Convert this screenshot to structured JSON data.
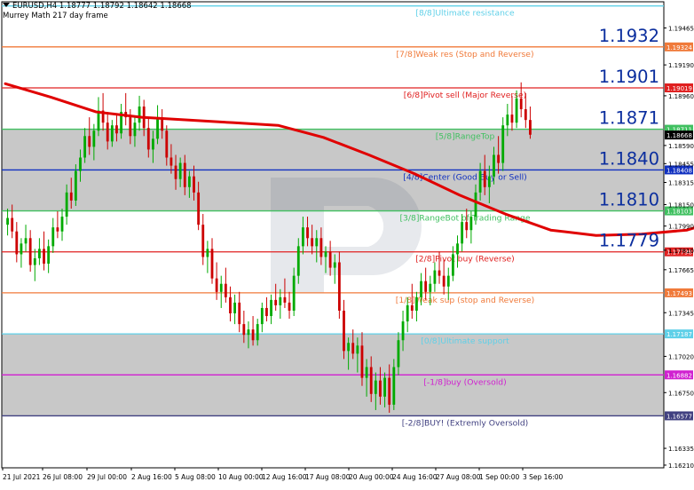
{
  "header": {
    "symbol_line": "EURUSD,H4  1.18777 1.18792 1.18642 1.18668",
    "indicator_line": "Murrey Math 217 day frame"
  },
  "colors": {
    "band_fill": "#c8c8c8",
    "bull": "#00aa00",
    "bear": "#cc0000",
    "ma": "#e00000",
    "arrow": "#0a2fd8",
    "big_label": "#0b2e9e"
  },
  "chart_data": {
    "type": "candlestick",
    "symbol": "EURUSD",
    "timeframe": "H4",
    "ohlc_last": {
      "open": 1.18777,
      "high": 1.18792,
      "low": 1.18642,
      "close": 1.18668
    },
    "ylim": [
      1.1619,
      1.1966
    ],
    "yticks": [
      1.19465,
      1.1919,
      1.1896,
      1.1859,
      1.18455,
      1.18315,
      1.1815,
      1.1799,
      1.1781,
      1.17665,
      1.17345,
      1.1702,
      1.1675,
      1.16335,
      1.1621
    ],
    "x_tick_labels": [
      "21 Jul 2021",
      "26 Jul 08:00",
      "29 Jul 00:00",
      "2 Aug 16:00",
      "5 Aug 08:00",
      "10 Aug 00:00",
      "12 Aug 16:00",
      "17 Aug 08:00",
      "20 Aug 00:00",
      "24 Aug 16:00",
      "27 Aug 08:00",
      "1 Sep 00:00",
      "3 Sep 16:00"
    ],
    "murrey_levels": [
      {
        "name": "[8/8]Ultimate resistance",
        "price": 1.19629,
        "color": "#5fd0e8",
        "price_label": ""
      },
      {
        "name": "[7/8]Weak res (Stop and Reverse)",
        "price": 1.19324,
        "color": "#f07a3a",
        "price_label": "1.19324"
      },
      {
        "name": "[6/8]Pivot sell (Major Reverse)",
        "price": 1.19019,
        "color": "#e02020",
        "price_label": "1.19019"
      },
      {
        "name": "[5/8]RangeTop",
        "price": 1.18711,
        "color": "#40c060",
        "price_label": "1.18711"
      },
      {
        "name": "[4/8]Center (Good Buy or Sell)",
        "price": 1.18408,
        "color": "#1030c0",
        "price_label": "1.18408"
      },
      {
        "name": "[3/8]RangeBot of Trading Range",
        "price": 1.18103,
        "color": "#40c060",
        "price_label": "1.18103"
      },
      {
        "name": "[2/8]Pivot buy (Reverse)",
        "price": 1.17798,
        "color": "#e02020",
        "price_label": "1.17798"
      },
      {
        "name": "[1/8]Weak sup (stop and Reverse)",
        "price": 1.17493,
        "color": "#f07a3a",
        "price_label": "1.17493"
      },
      {
        "name": "[0/8]Ultimate support",
        "price": 1.17187,
        "color": "#5fd0e8",
        "price_label": "1.17187"
      },
      {
        "name": "[-1/8]buy (Oversold)",
        "price": 1.16882,
        "color": "#d020d0",
        "price_label": "1.16882"
      },
      {
        "name": "[-2/8]BUY! (Extremly Oversold)",
        "price": 1.16577,
        "color": "#404080",
        "price_label": "1.16577"
      }
    ],
    "current_price_label": "1.18668",
    "big_labels": [
      "1.1932",
      "1.1901",
      "1.1871",
      "1.1840",
      "1.1810",
      "1.1779"
    ],
    "moving_average": {
      "period_label": "217 day frame",
      "points": [
        [
          0,
          1.1905
        ],
        [
          10,
          1.1895
        ],
        [
          20,
          1.1884
        ],
        [
          30,
          1.188
        ],
        [
          40,
          1.1878
        ],
        [
          50,
          1.1876
        ],
        [
          60,
          1.1874
        ],
        [
          70,
          1.1865
        ],
        [
          80,
          1.1852
        ],
        [
          90,
          1.1838
        ],
        [
          100,
          1.1822
        ],
        [
          110,
          1.1808
        ],
        [
          120,
          1.1796
        ],
        [
          130,
          1.1792
        ],
        [
          140,
          1.1793
        ],
        [
          150,
          1.1796
        ],
        [
          158,
          1.1804
        ]
      ]
    },
    "projection_arrows": [
      {
        "from": [
          161,
          1.1866
        ],
        "to": [
          164,
          1.184
        ]
      },
      {
        "from": [
          164,
          1.184
        ],
        "to": [
          168,
          1.1872
        ]
      },
      {
        "from": [
          168,
          1.1872
        ],
        "to": [
          172,
          1.1898
        ]
      }
    ],
    "candles": [
      [
        1.18,
        1.1812,
        1.1792,
        1.1805
      ],
      [
        1.1805,
        1.1815,
        1.179,
        1.1795
      ],
      [
        1.1795,
        1.1802,
        1.1772,
        1.1778
      ],
      [
        1.1778,
        1.179,
        1.1768,
        1.1786
      ],
      [
        1.1786,
        1.18,
        1.178,
        1.179
      ],
      [
        1.179,
        1.1796,
        1.1765,
        1.177
      ],
      [
        1.177,
        1.1782,
        1.1758,
        1.1775
      ],
      [
        1.1775,
        1.179,
        1.177,
        1.1782
      ],
      [
        1.1782,
        1.1795,
        1.1766,
        1.1771
      ],
      [
        1.1771,
        1.1789,
        1.1764,
        1.1784
      ],
      [
        1.1784,
        1.1805,
        1.1779,
        1.1798
      ],
      [
        1.1798,
        1.181,
        1.179,
        1.1795
      ],
      [
        1.1795,
        1.1812,
        1.1788,
        1.1806
      ],
      [
        1.1806,
        1.183,
        1.18,
        1.1824
      ],
      [
        1.1824,
        1.1835,
        1.1812,
        1.1818
      ],
      [
        1.1818,
        1.1845,
        1.1814,
        1.184
      ],
      [
        1.184,
        1.1856,
        1.1832,
        1.185
      ],
      [
        1.185,
        1.1872,
        1.1846,
        1.1866
      ],
      [
        1.1866,
        1.188,
        1.1852,
        1.1858
      ],
      [
        1.1858,
        1.1875,
        1.1848,
        1.187
      ],
      [
        1.187,
        1.1895,
        1.1866,
        1.1885
      ],
      [
        1.1885,
        1.1898,
        1.187,
        1.1876
      ],
      [
        1.1876,
        1.1884,
        1.1856,
        1.1862
      ],
      [
        1.1862,
        1.1878,
        1.1858,
        1.1874
      ],
      [
        1.1874,
        1.1882,
        1.1862,
        1.1868
      ],
      [
        1.1868,
        1.189,
        1.1864,
        1.1884
      ],
      [
        1.1884,
        1.1898,
        1.1874,
        1.188
      ],
      [
        1.188,
        1.1886,
        1.186,
        1.1866
      ],
      [
        1.1866,
        1.188,
        1.1858,
        1.1876
      ],
      [
        1.1876,
        1.1896,
        1.187,
        1.1888
      ],
      [
        1.1888,
        1.1893,
        1.1866,
        1.1872
      ],
      [
        1.1872,
        1.188,
        1.185,
        1.1856
      ],
      [
        1.1856,
        1.187,
        1.1846,
        1.1864
      ],
      [
        1.1864,
        1.1889,
        1.186,
        1.188
      ],
      [
        1.188,
        1.1886,
        1.1864,
        1.187
      ],
      [
        1.187,
        1.1874,
        1.1844,
        1.185
      ],
      [
        1.185,
        1.186,
        1.1838,
        1.1844
      ],
      [
        1.1844,
        1.1852,
        1.1826,
        1.1834
      ],
      [
        1.1834,
        1.185,
        1.1828,
        1.1846
      ],
      [
        1.1846,
        1.1852,
        1.1822,
        1.1828
      ],
      [
        1.1828,
        1.184,
        1.182,
        1.1836
      ],
      [
        1.1836,
        1.1844,
        1.1818,
        1.1824
      ],
      [
        1.1824,
        1.1832,
        1.1796,
        1.18
      ],
      [
        1.18,
        1.1808,
        1.177,
        1.1776
      ],
      [
        1.1776,
        1.1788,
        1.1764,
        1.1782
      ],
      [
        1.1782,
        1.179,
        1.1756,
        1.176
      ],
      [
        1.176,
        1.1772,
        1.1744,
        1.175
      ],
      [
        1.175,
        1.1762,
        1.1738,
        1.1756
      ],
      [
        1.1756,
        1.1768,
        1.1742,
        1.1746
      ],
      [
        1.1746,
        1.1754,
        1.1728,
        1.1734
      ],
      [
        1.1734,
        1.1748,
        1.1726,
        1.1742
      ],
      [
        1.1742,
        1.175,
        1.172,
        1.1726
      ],
      [
        1.1726,
        1.1736,
        1.1712,
        1.1718
      ],
      [
        1.1718,
        1.1728,
        1.1708,
        1.1722
      ],
      [
        1.1722,
        1.1732,
        1.171,
        1.1714
      ],
      [
        1.1714,
        1.173,
        1.171,
        1.1726
      ],
      [
        1.1726,
        1.1742,
        1.172,
        1.1738
      ],
      [
        1.1738,
        1.1746,
        1.1728,
        1.1732
      ],
      [
        1.1732,
        1.1748,
        1.1726,
        1.1744
      ],
      [
        1.1744,
        1.1756,
        1.1736,
        1.174
      ],
      [
        1.174,
        1.1752,
        1.173,
        1.1746
      ],
      [
        1.1746,
        1.176,
        1.1738,
        1.1742
      ],
      [
        1.1742,
        1.175,
        1.173,
        1.1736
      ],
      [
        1.1736,
        1.1768,
        1.1732,
        1.1762
      ],
      [
        1.1762,
        1.179,
        1.1756,
        1.1784
      ],
      [
        1.1784,
        1.1806,
        1.1778,
        1.1798
      ],
      [
        1.1798,
        1.1806,
        1.1784,
        1.179
      ],
      [
        1.179,
        1.18,
        1.1778,
        1.1784
      ],
      [
        1.1784,
        1.1796,
        1.1772,
        1.179
      ],
      [
        1.179,
        1.1798,
        1.177,
        1.1776
      ],
      [
        1.1776,
        1.1784,
        1.1764,
        1.178
      ],
      [
        1.178,
        1.1788,
        1.1762,
        1.1768
      ],
      [
        1.1768,
        1.1778,
        1.1756,
        1.1772
      ],
      [
        1.1772,
        1.178,
        1.173,
        1.1736
      ],
      [
        1.1736,
        1.1744,
        1.17,
        1.1706
      ],
      [
        1.1706,
        1.1716,
        1.1692,
        1.1712
      ],
      [
        1.1712,
        1.1722,
        1.17,
        1.1704
      ],
      [
        1.1704,
        1.1716,
        1.169,
        1.171
      ],
      [
        1.171,
        1.172,
        1.168,
        1.1686
      ],
      [
        1.1686,
        1.17,
        1.1672,
        1.1694
      ],
      [
        1.1694,
        1.1702,
        1.1668,
        1.1674
      ],
      [
        1.1674,
        1.169,
        1.1662,
        1.1684
      ],
      [
        1.1684,
        1.1694,
        1.1666,
        1.1672
      ],
      [
        1.1672,
        1.169,
        1.1664,
        1.1686
      ],
      [
        1.1686,
        1.1696,
        1.166,
        1.1666
      ],
      [
        1.1666,
        1.17,
        1.1662,
        1.1694
      ],
      [
        1.1694,
        1.172,
        1.1688,
        1.1714
      ],
      [
        1.1714,
        1.1736,
        1.1706,
        1.1728
      ],
      [
        1.1728,
        1.1746,
        1.172,
        1.174
      ],
      [
        1.174,
        1.1756,
        1.173,
        1.1736
      ],
      [
        1.1736,
        1.175,
        1.1728,
        1.1746
      ],
      [
        1.1746,
        1.1764,
        1.174,
        1.1758
      ],
      [
        1.1758,
        1.1768,
        1.1744,
        1.175
      ],
      [
        1.175,
        1.1762,
        1.174,
        1.1756
      ],
      [
        1.1756,
        1.1772,
        1.175,
        1.1766
      ],
      [
        1.1766,
        1.178,
        1.1756,
        1.1762
      ],
      [
        1.1762,
        1.1774,
        1.1748,
        1.1754
      ],
      [
        1.1754,
        1.1768,
        1.1744,
        1.1762
      ],
      [
        1.1762,
        1.1784,
        1.1758,
        1.1778
      ],
      [
        1.1778,
        1.1792,
        1.1768,
        1.1786
      ],
      [
        1.1786,
        1.1808,
        1.178,
        1.1802
      ],
      [
        1.1802,
        1.1812,
        1.179,
        1.1796
      ],
      [
        1.1796,
        1.181,
        1.1786,
        1.1806
      ],
      [
        1.1806,
        1.183,
        1.18,
        1.1824
      ],
      [
        1.1824,
        1.1846,
        1.1818,
        1.184
      ],
      [
        1.184,
        1.1852,
        1.1822,
        1.1828
      ],
      [
        1.1828,
        1.1844,
        1.1816,
        1.1836
      ],
      [
        1.1836,
        1.1858,
        1.183,
        1.1852
      ],
      [
        1.1852,
        1.1866,
        1.1838,
        1.1846
      ],
      [
        1.1846,
        1.188,
        1.184,
        1.1874
      ],
      [
        1.1874,
        1.189,
        1.1866,
        1.1882
      ],
      [
        1.1882,
        1.1896,
        1.187,
        1.1876
      ],
      [
        1.1876,
        1.19,
        1.1872,
        1.1894
      ],
      [
        1.1894,
        1.1906,
        1.188,
        1.1886
      ],
      [
        1.1886,
        1.1898,
        1.1872,
        1.1878
      ],
      [
        1.1878,
        1.1888,
        1.1864,
        1.1867
      ]
    ]
  }
}
